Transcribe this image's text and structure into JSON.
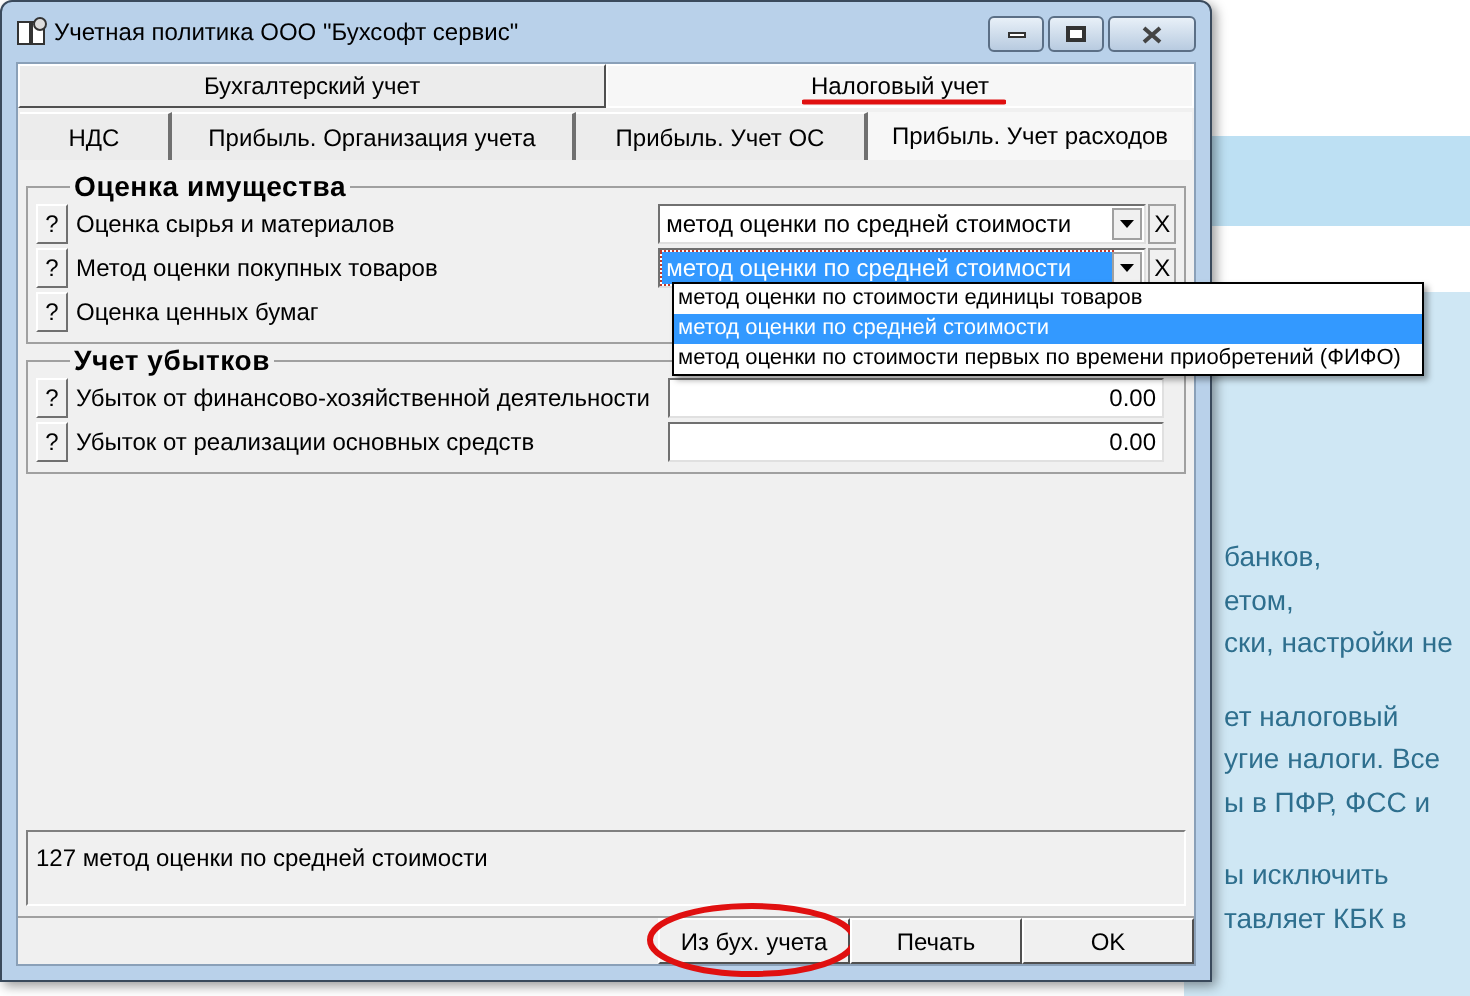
{
  "window": {
    "title": "Учетная политика ООО \"Бухсофт сервис\""
  },
  "main_tabs": [
    {
      "label": "Бухгалтерский учет",
      "selected": false,
      "annotated": false
    },
    {
      "label": "Налоговый учет",
      "selected": true,
      "annotated": true
    }
  ],
  "sub_tabs": [
    {
      "label": "НДС",
      "selected": false
    },
    {
      "label": "Прибыль. Организация учета",
      "selected": false
    },
    {
      "label": "Прибыль. Учет ОС",
      "selected": false
    },
    {
      "label": "Прибыль. Учет расходов",
      "selected": true
    }
  ],
  "groups": [
    {
      "title": "Оценка имущества",
      "rows": [
        {
          "help": "?",
          "label": "Оценка сырья и материалов",
          "kind": "select",
          "value": "метод оценки по средней стоимости",
          "focused": false,
          "clear": "X"
        },
        {
          "help": "?",
          "label": "Метод оценки покупных товаров",
          "kind": "select",
          "value": "метод оценки по средней стоимости",
          "focused": true,
          "clear": "X"
        },
        {
          "help": "?",
          "label": "Оценка ценных бумаг",
          "kind": "plain"
        }
      ]
    },
    {
      "title": "Учет убытков",
      "rows": [
        {
          "help": "?",
          "label": "Убыток от финансово-хозяйственной деятельности",
          "kind": "number",
          "value": "0.00"
        },
        {
          "help": "?",
          "label": "Убыток от реализации основных средств",
          "kind": "number",
          "value": "0.00"
        }
      ]
    }
  ],
  "dropdown": {
    "options": [
      {
        "label": "метод оценки по стоимости единицы товаров",
        "selected": false
      },
      {
        "label": "метод оценки по средней стоимости",
        "selected": true
      },
      {
        "label": "метод оценки по стоимости первых по времени приобретений (ФИФО)",
        "selected": false
      }
    ]
  },
  "description": "127 метод оценки по средней стоимости",
  "buttons": [
    {
      "label": "Из бух. учета",
      "annotated": true
    },
    {
      "label": "Печать",
      "annotated": false
    },
    {
      "label": "OK",
      "annotated": false
    }
  ],
  "background_paragraphs": [
    {
      "lines": [
        "банков,",
        "етом,",
        "ски, настройки не"
      ]
    },
    {
      "lines": [
        "ет налоговый",
        "угие налоги. Все",
        "ы в ПФР, ФСС и"
      ]
    },
    {
      "lines": [
        "ы исключить",
        "тавляет КБК в"
      ]
    }
  ]
}
